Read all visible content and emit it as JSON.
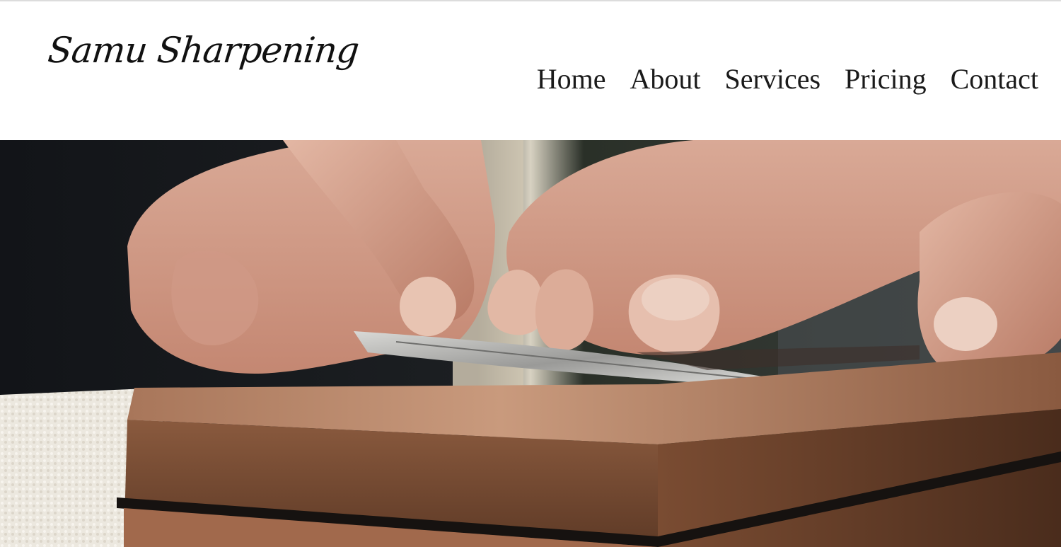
{
  "brand": {
    "name": "Samu Sharpening"
  },
  "nav": {
    "items": [
      {
        "label": "Home"
      },
      {
        "label": "About"
      },
      {
        "label": "Services"
      },
      {
        "label": "Pricing"
      },
      {
        "label": "Contact"
      }
    ]
  },
  "hero": {
    "image": "hands-sharpening-knife-on-whetstone"
  },
  "colors": {
    "background": "#ffffff",
    "nav_text": "#1a1a1a",
    "logo_text": "#111111",
    "stone": "#7a4a2e",
    "towel": "#ece8df"
  }
}
